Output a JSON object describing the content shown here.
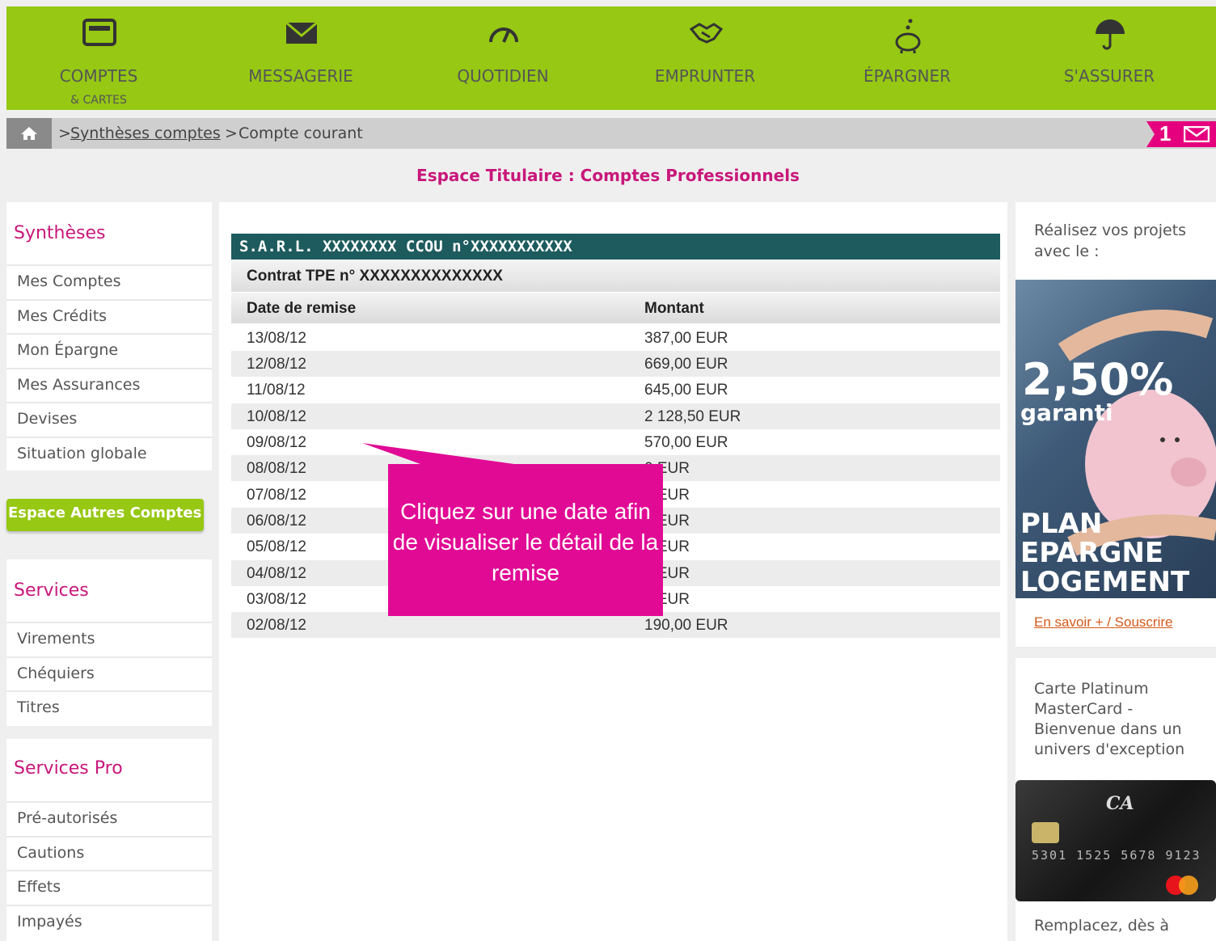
{
  "nav": {
    "items": [
      {
        "label": "COMPTES",
        "sub": "& CARTES",
        "icon": "card-icon"
      },
      {
        "label": "MESSAGERIE",
        "icon": "envelope-icon"
      },
      {
        "label": "QUOTIDIEN",
        "icon": "gauge-icon"
      },
      {
        "label": "EMPRUNTER",
        "icon": "handshake-icon"
      },
      {
        "label": "ÉPARGNER",
        "icon": "piggy-bank-icon"
      },
      {
        "label": "S'ASSURER",
        "icon": "umbrella-icon"
      }
    ]
  },
  "breadcrumb": {
    "sep1": ">",
    "link": "Synthèses comptes",
    "sep2": ">",
    "current": "Compte courant"
  },
  "messages": {
    "count": "1"
  },
  "page_heading": "Espace Titulaire : Comptes Professionnels",
  "sidebar": {
    "synth_title": "Synthèses",
    "synth_items": [
      "Mes Comptes",
      "Mes Crédits",
      "Mon Épargne",
      "Mes Assurances",
      "Devises",
      "Situation globale"
    ],
    "other_accounts": "Espace Autres Comptes",
    "services_title": "Services",
    "services_items": [
      "Virements",
      "Chéquiers",
      "Titres"
    ],
    "pro_title": "Services Pro",
    "pro_items": [
      "Pré-autorisés",
      "Cautions",
      "Effets",
      "Impayés"
    ]
  },
  "account": {
    "header": "S.A.R.L. XXXXXXXX CCOU n°XXXXXXXXXXX",
    "contract": "Contrat TPE n° XXXXXXXXXXXXXX",
    "col_date": "Date de remise",
    "col_amount": "Montant",
    "rows": [
      {
        "date": "13/08/12",
        "amount": "387,00 EUR"
      },
      {
        "date": "12/08/12",
        "amount": "669,00 EUR"
      },
      {
        "date": "11/08/12",
        "amount": "645,00 EUR"
      },
      {
        "date": "10/08/12",
        "amount": "2 128,50 EUR"
      },
      {
        "date": "09/08/12",
        "amount": "570,00 EUR"
      },
      {
        "date": "08/08/12",
        "amount": "0 EUR"
      },
      {
        "date": "07/08/12",
        "amount": "0 EUR"
      },
      {
        "date": "06/08/12",
        "amount": "0 EUR"
      },
      {
        "date": "05/08/12",
        "amount": "0 EUR"
      },
      {
        "date": "04/08/12",
        "amount": "0 EUR"
      },
      {
        "date": "03/08/12",
        "amount": "0 EUR"
      },
      {
        "date": "02/08/12",
        "amount": "190,00 EUR"
      }
    ]
  },
  "callout": {
    "text": "Cliquez sur une date afin de visualiser le détail de la remise"
  },
  "promo1": {
    "text": "Réalisez vos projets avec le :",
    "rate": "2,50%",
    "garanti": "garanti",
    "name_lines": [
      "PLAN",
      "EPARGNE",
      "LOGEMENT"
    ],
    "link": "En savoir + / Souscrire"
  },
  "promo2": {
    "text": "Carte Platinum MasterCard - Bienvenue dans un univers d'exception",
    "card_number": "5301 1525 5678 9123"
  },
  "promo3": {
    "text": "Remplacez, dès à"
  },
  "colors": {
    "brand_green": "#96c814",
    "accent_pink": "#e5007e",
    "heading_pink": "#c8177a",
    "teal": "#1d5b5e"
  }
}
